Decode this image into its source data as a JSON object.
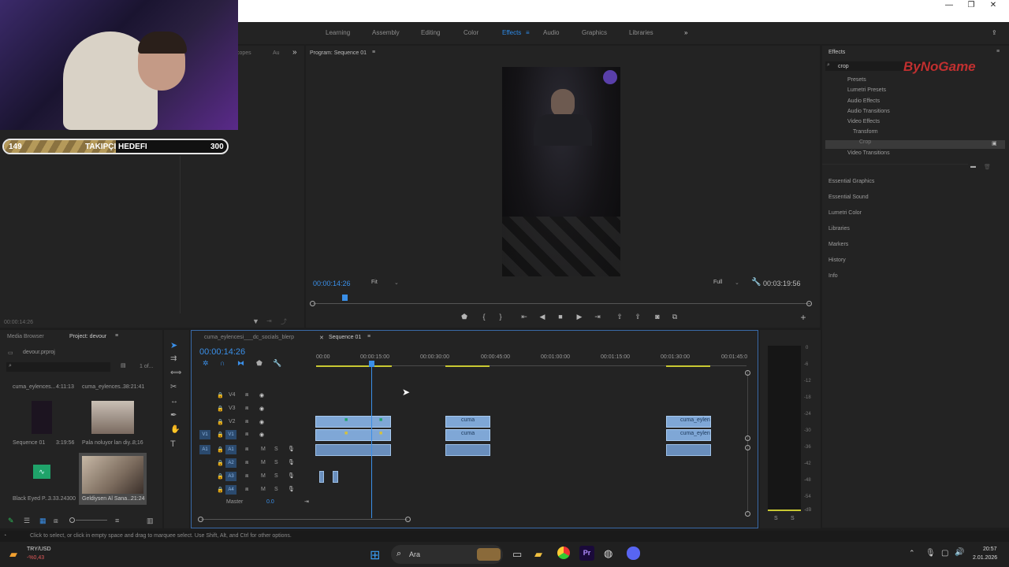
{
  "window": {
    "minimize": "—",
    "maximize": "❐",
    "close": "✕"
  },
  "workspaces": [
    {
      "label": "Learning"
    },
    {
      "label": "Assembly"
    },
    {
      "label": "Editing"
    },
    {
      "label": "Color"
    },
    {
      "label": "Effects"
    },
    {
      "label": "Audio"
    },
    {
      "label": "Graphics"
    },
    {
      "label": "Libraries"
    }
  ],
  "stream": {
    "goal_start": "149",
    "goal_label": "TAKIPÇI HEDEFI",
    "goal_end": "300",
    "goal_progress": 0.5,
    "watermark": "ByNoGame"
  },
  "source_panel": {
    "tab_scopes": "copes",
    "tab_au": "Au",
    "timecode": "00:00:14:26"
  },
  "program_monitor": {
    "title": "Program: Sequence 01",
    "timecode": "00:00:14:26",
    "fit": "Fit",
    "quality": "Full",
    "duration": "00:03:19:56"
  },
  "effects_panel": {
    "title": "Effects",
    "search_value": "crop",
    "tree": [
      {
        "label": "Presets"
      },
      {
        "label": "Lumetri Presets"
      },
      {
        "label": "Audio Effects"
      },
      {
        "label": "Audio Transitions"
      },
      {
        "label": "Video Effects"
      },
      {
        "label": "Transform"
      },
      {
        "label": "Crop"
      },
      {
        "label": "Video Transitions"
      }
    ],
    "sections": [
      {
        "label": "Essential Graphics"
      },
      {
        "label": "Essential Sound"
      },
      {
        "label": "Lumetri Color"
      },
      {
        "label": "Libraries"
      },
      {
        "label": "Markers"
      },
      {
        "label": "History"
      },
      {
        "label": "Info"
      }
    ]
  },
  "project_panel": {
    "tab_media": "Media Browser",
    "tab_project": "Project: devour",
    "file": "devour.prproj",
    "page": "1 of...",
    "items": [
      {
        "name": "cuma_eylences...",
        "duration": "4:11:13"
      },
      {
        "name": "cuma_eylences...",
        "duration": "38:21:41"
      },
      {
        "name": "Sequence 01",
        "duration": "3:19:56"
      },
      {
        "name": "Pala noluyor lan diy...",
        "duration": "8;16"
      },
      {
        "name": "Black Eyed P...",
        "duration": "3.33.24300"
      },
      {
        "name": "Geldiysen Al Sana...",
        "duration": "21:24"
      }
    ]
  },
  "timeline": {
    "tab1": "cuma_eylencesi___dc_socials_blerp",
    "tab2": "Sequence 01",
    "timecode": "00:00:14:26",
    "ruler": [
      "00:00",
      "00:00:15:00",
      "00:00:30:00",
      "00:00:45:00",
      "00:01:00:00",
      "00:01:15:00",
      "00:01:30:00",
      "00:01:45:0"
    ],
    "tracks": [
      {
        "name": "V4"
      },
      {
        "name": "V3"
      },
      {
        "name": "V2"
      },
      {
        "name": "V1"
      },
      {
        "name": "A1"
      },
      {
        "name": "A2"
      },
      {
        "name": "A3"
      },
      {
        "name": "A4"
      }
    ],
    "master": "Master",
    "master_value": "0.0",
    "clip_label_1": "cuma",
    "clip_label_2": "cuma_eylen"
  },
  "meter": {
    "ticks": [
      "0",
      "-6",
      "-12",
      "-18",
      "-24",
      "-30",
      "-36",
      "-42",
      "-48",
      "-54",
      "-dB"
    ],
    "solo_left": "S",
    "solo_right": "S"
  },
  "status_text": "Click to select, or click in empty space and drag to marquee select. Use Shift, Alt, and Ctrl for other options.",
  "taskbar": {
    "ticker_label": "TRY/USD",
    "ticker_value": "-%0,43",
    "search_placeholder": "Ara",
    "time": "20:57",
    "date": "2.01.2026"
  }
}
